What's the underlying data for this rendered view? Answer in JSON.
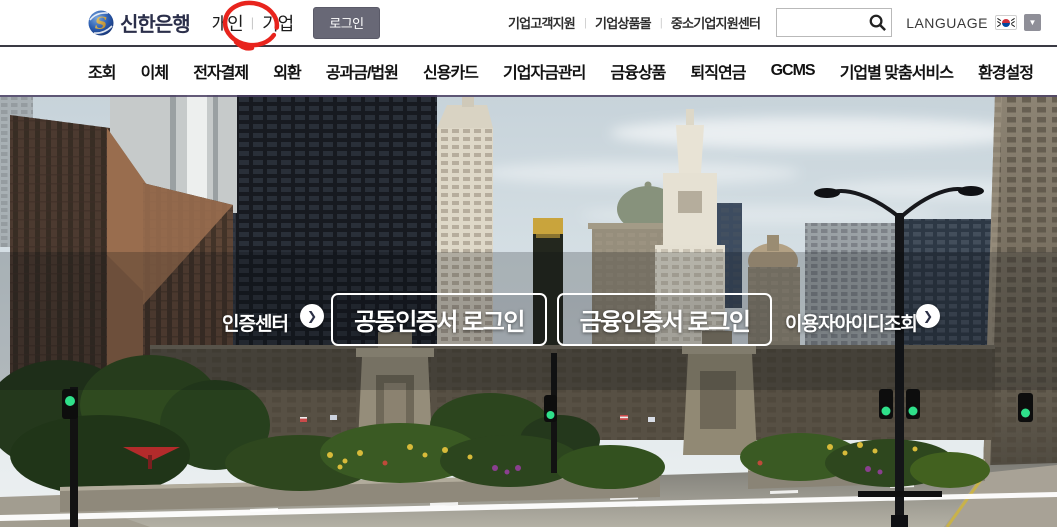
{
  "brand": {
    "name": "신한은행"
  },
  "header": {
    "separator": "|",
    "segments": {
      "personal": "개인",
      "corporate": "기업"
    },
    "login_button": "로그인",
    "utility_links": [
      "기업고객지원",
      "기업상품몰",
      "중소기업지원센터"
    ],
    "search": {
      "placeholder": "",
      "value": ""
    },
    "language": {
      "label": "LANGUAGE",
      "flag": "korean-flag",
      "dropdown_glyph": "▼"
    }
  },
  "nav": {
    "items": [
      "조회",
      "이체",
      "전자결제",
      "외환",
      "공과금/법원",
      "신용카드",
      "기업자금관리",
      "금융상품",
      "퇴직연금",
      "GCMS",
      "기업별 맞춤서비스",
      "환경설정"
    ]
  },
  "hero": {
    "cert_center_label": "인증센터",
    "login_buttons": [
      "공동인증서 로그인",
      "금융인증서 로그인"
    ],
    "user_id_lookup_label": "이용자아이디조회",
    "arrow_glyph": "❯"
  },
  "annotation": {
    "type": "hand-drawn-red-circle",
    "target": "기업",
    "color": "#e8241d"
  },
  "colors": {
    "login_button_bg": "#686876",
    "header_border": "#3a3a44",
    "logo_blue": "#1f4fa0",
    "logo_gold": "#d9a937",
    "hero_button_border": "#ffffff"
  }
}
